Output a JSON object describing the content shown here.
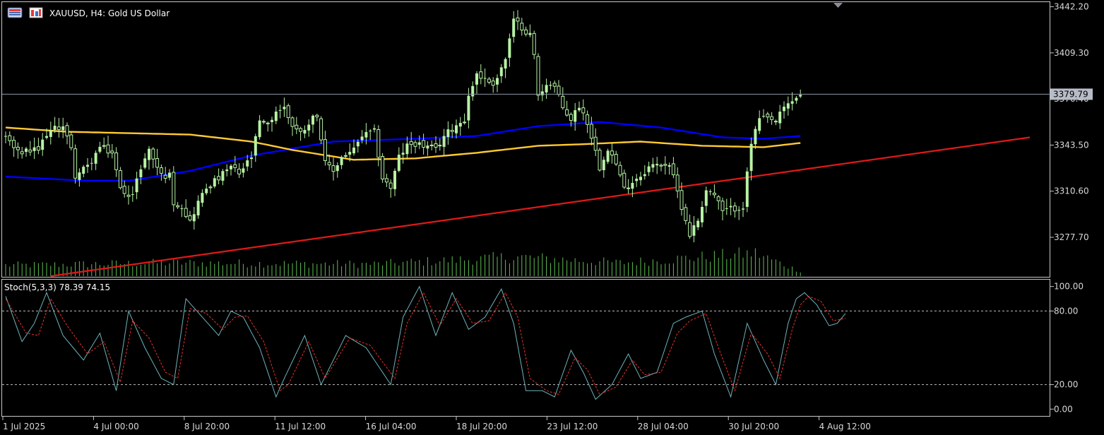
{
  "header": {
    "symbol_info": "XAUUSD, H4:  Gold US Dollar",
    "icons": [
      "list-menu-icon",
      "chart-type-icon"
    ],
    "marker_icon": "triangle-down-icon"
  },
  "chart_data": [
    {
      "type": "candlestick",
      "title": "XAUUSD, H4:  Gold US Dollar",
      "ylim": [
        3250.0,
        3445.0
      ],
      "y_ticks": [
        "3442.20",
        "3409.30",
        "3376.40",
        "3343.50",
        "3310.60",
        "3277.70"
      ],
      "x_ticks": [
        "1 Jul 2025",
        "4 Jul 00:00",
        "8 Jul 20:00",
        "11 Jul 12:00",
        "16 Jul 04:00",
        "18 Jul 20:00",
        "23 Jul 12:00",
        "28 Jul 04:00",
        "30 Jul 20:00",
        "4 Aug 12:00"
      ],
      "current_price": "3379.79",
      "candle_keyframes": [
        [
          0,
          3350
        ],
        [
          3,
          3338
        ],
        [
          8,
          3340
        ],
        [
          10,
          3352
        ],
        [
          14,
          3358
        ],
        [
          16,
          3340
        ],
        [
          17,
          3322
        ],
        [
          20,
          3328
        ],
        [
          23,
          3342
        ],
        [
          26,
          3338
        ],
        [
          28,
          3312
        ],
        [
          31,
          3308
        ],
        [
          33,
          3328
        ],
        [
          35,
          3340
        ],
        [
          38,
          3322
        ],
        [
          40,
          3322
        ],
        [
          41,
          3303
        ],
        [
          43,
          3300
        ],
        [
          45,
          3289
        ],
        [
          47,
          3303
        ],
        [
          49,
          3313
        ],
        [
          52,
          3320
        ],
        [
          55,
          3328
        ],
        [
          57,
          3323
        ],
        [
          60,
          3335
        ],
        [
          62,
          3360
        ],
        [
          64,
          3357
        ],
        [
          66,
          3368
        ],
        [
          68,
          3370
        ],
        [
          70,
          3358
        ],
        [
          72,
          3352
        ],
        [
          74,
          3360
        ],
        [
          76,
          3366
        ],
        [
          78,
          3330
        ],
        [
          80,
          3325
        ],
        [
          82,
          3335
        ],
        [
          85,
          3340
        ],
        [
          87,
          3350
        ],
        [
          90,
          3353
        ],
        [
          92,
          3320
        ],
        [
          94,
          3313
        ],
        [
          96,
          3335
        ],
        [
          98,
          3343
        ],
        [
          100,
          3345
        ],
        [
          102,
          3343
        ],
        [
          105,
          3340
        ],
        [
          107,
          3350
        ],
        [
          110,
          3358
        ],
        [
          112,
          3362
        ],
        [
          113,
          3378
        ],
        [
          115,
          3395
        ],
        [
          117,
          3390
        ],
        [
          119,
          3388
        ],
        [
          120,
          3392
        ],
        [
          122,
          3405
        ],
        [
          124,
          3432
        ],
        [
          126,
          3428
        ],
        [
          128,
          3422
        ],
        [
          129,
          3408
        ],
        [
          130,
          3378
        ],
        [
          132,
          3388
        ],
        [
          134,
          3385
        ],
        [
          136,
          3370
        ],
        [
          138,
          3362
        ],
        [
          140,
          3372
        ],
        [
          142,
          3360
        ],
        [
          143,
          3350
        ],
        [
          145,
          3328
        ],
        [
          147,
          3342
        ],
        [
          149,
          3330
        ],
        [
          151,
          3312
        ],
        [
          153,
          3318
        ],
        [
          155,
          3322
        ],
        [
          157,
          3328
        ],
        [
          160,
          3330
        ],
        [
          162,
          3330
        ],
        [
          164,
          3310
        ],
        [
          166,
          3290
        ],
        [
          167,
          3280
        ],
        [
          169,
          3290
        ],
        [
          171,
          3312
        ],
        [
          173,
          3308
        ],
        [
          175,
          3296
        ],
        [
          177,
          3298
        ],
        [
          180,
          3300
        ],
        [
          182,
          3345
        ],
        [
          184,
          3362
        ],
        [
          186,
          3362
        ],
        [
          188,
          3360
        ],
        [
          190,
          3370
        ],
        [
          192,
          3375
        ],
        [
          194,
          3380
        ]
      ],
      "volume_keyframes": [
        [
          0,
          0.45
        ],
        [
          40,
          0.55
        ],
        [
          90,
          0.5
        ],
        [
          125,
          0.8
        ],
        [
          150,
          0.55
        ],
        [
          183,
          0.95
        ],
        [
          194,
          0.2
        ]
      ],
      "series": [
        {
          "name": "",
          "type": "line",
          "color": "#0000ff",
          "keyframes": [
            [
              0,
              3321
            ],
            [
              20,
              3318
            ],
            [
              30,
              3318
            ],
            [
              45,
              3325
            ],
            [
              60,
              3336
            ],
            [
              80,
              3346
            ],
            [
              100,
              3348
            ],
            [
              115,
              3350
            ],
            [
              130,
              3357
            ],
            [
              145,
              3360
            ],
            [
              160,
              3356
            ],
            [
              175,
              3349
            ],
            [
              185,
              3348
            ],
            [
              194,
              3350
            ]
          ]
        },
        {
          "name": "",
          "type": "line",
          "color": "#ffc933",
          "keyframes": [
            [
              0,
              3356
            ],
            [
              15,
              3353
            ],
            [
              30,
              3352
            ],
            [
              45,
              3351
            ],
            [
              60,
              3346
            ],
            [
              70,
              3340
            ],
            [
              85,
              3333
            ],
            [
              100,
              3334
            ],
            [
              115,
              3338
            ],
            [
              130,
              3343
            ],
            [
              140,
              3344
            ],
            [
              155,
              3346
            ],
            [
              170,
              3343
            ],
            [
              185,
              3342
            ],
            [
              194,
              3345
            ]
          ]
        },
        {
          "name": "",
          "type": "line",
          "color": "#e01919",
          "points": [
            [
              11,
              3250
            ],
            [
              250,
              3349
            ]
          ]
        }
      ]
    },
    {
      "type": "line",
      "title": "Stoch(5,3,3) 78.39 74.15",
      "ylim": [
        -5,
        105
      ],
      "y_ticks": [
        "100.00",
        "80.00",
        "20.00",
        "0.00"
      ],
      "levels": [
        80,
        20
      ],
      "series": [
        {
          "name": "",
          "color": "#6fb3ba",
          "keyframes": [
            [
              0,
              92
            ],
            [
              4,
              55
            ],
            [
              7,
              70
            ],
            [
              10,
              95
            ],
            [
              14,
              60
            ],
            [
              19,
              40
            ],
            [
              23,
              62
            ],
            [
              27,
              15
            ],
            [
              30,
              80
            ],
            [
              34,
              50
            ],
            [
              38,
              25
            ],
            [
              41,
              20
            ],
            [
              44,
              90
            ],
            [
              48,
              75
            ],
            [
              52,
              60
            ],
            [
              55,
              80
            ],
            [
              58,
              75
            ],
            [
              62,
              50
            ],
            [
              66,
              10
            ],
            [
              68,
              25
            ],
            [
              73,
              60
            ],
            [
              77,
              20
            ],
            [
              83,
              60
            ],
            [
              88,
              50
            ],
            [
              94,
              20
            ],
            [
              97,
              75
            ],
            [
              101,
              100
            ],
            [
              105,
              60
            ],
            [
              109,
              95
            ],
            [
              113,
              65
            ],
            [
              117,
              75
            ],
            [
              121,
              98
            ],
            [
              124,
              70
            ],
            [
              127,
              15
            ],
            [
              131,
              15
            ],
            [
              134,
              10
            ],
            [
              138,
              48
            ],
            [
              141,
              30
            ],
            [
              144,
              8
            ],
            [
              148,
              20
            ],
            [
              152,
              45
            ],
            [
              155,
              25
            ],
            [
              159,
              30
            ],
            [
              163,
              70
            ],
            [
              166,
              75
            ],
            [
              170,
              80
            ],
            [
              173,
              45
            ],
            [
              177,
              10
            ],
            [
              181,
              70
            ],
            [
              185,
              40
            ],
            [
              188,
              20
            ],
            [
              191,
              70
            ],
            [
              193,
              90
            ],
            [
              195,
              95
            ],
            [
              198,
              85
            ],
            [
              201,
              68
            ],
            [
              203,
              70
            ],
            [
              205,
              78
            ]
          ]
        },
        {
          "name": "",
          "color": "#e8322a",
          "style": "dashed",
          "keyframes": [
            [
              0,
              90
            ],
            [
              5,
              62
            ],
            [
              8,
              60
            ],
            [
              11,
              90
            ],
            [
              15,
              68
            ],
            [
              20,
              45
            ],
            [
              24,
              55
            ],
            [
              28,
              22
            ],
            [
              31,
              72
            ],
            [
              35,
              58
            ],
            [
              39,
              30
            ],
            [
              42,
              25
            ],
            [
              45,
              82
            ],
            [
              49,
              78
            ],
            [
              53,
              65
            ],
            [
              56,
              75
            ],
            [
              59,
              76
            ],
            [
              63,
              55
            ],
            [
              67,
              15
            ],
            [
              69,
              20
            ],
            [
              74,
              55
            ],
            [
              78,
              25
            ],
            [
              84,
              58
            ],
            [
              89,
              52
            ],
            [
              95,
              25
            ],
            [
              98,
              70
            ],
            [
              102,
              95
            ],
            [
              106,
              68
            ],
            [
              110,
              90
            ],
            [
              114,
              70
            ],
            [
              118,
              72
            ],
            [
              122,
              95
            ],
            [
              125,
              75
            ],
            [
              128,
              25
            ],
            [
              132,
              15
            ],
            [
              135,
              12
            ],
            [
              139,
              42
            ],
            [
              142,
              32
            ],
            [
              145,
              12
            ],
            [
              149,
              18
            ],
            [
              153,
              40
            ],
            [
              156,
              28
            ],
            [
              160,
              30
            ],
            [
              164,
              62
            ],
            [
              167,
              72
            ],
            [
              171,
              78
            ],
            [
              174,
              50
            ],
            [
              178,
              15
            ],
            [
              182,
              62
            ],
            [
              186,
              45
            ],
            [
              189,
              25
            ],
            [
              192,
              65
            ],
            [
              194,
              85
            ],
            [
              196,
              92
            ],
            [
              199,
              88
            ],
            [
              202,
              72
            ],
            [
              205,
              74
            ]
          ]
        }
      ]
    }
  ],
  "colors": {
    "background": "#000000",
    "frame": "#c8c8c8",
    "candle": "#b7f2a4",
    "volume": "#5fbf52",
    "grid": "#c8c8c8",
    "price_line": "#8e96a6"
  }
}
